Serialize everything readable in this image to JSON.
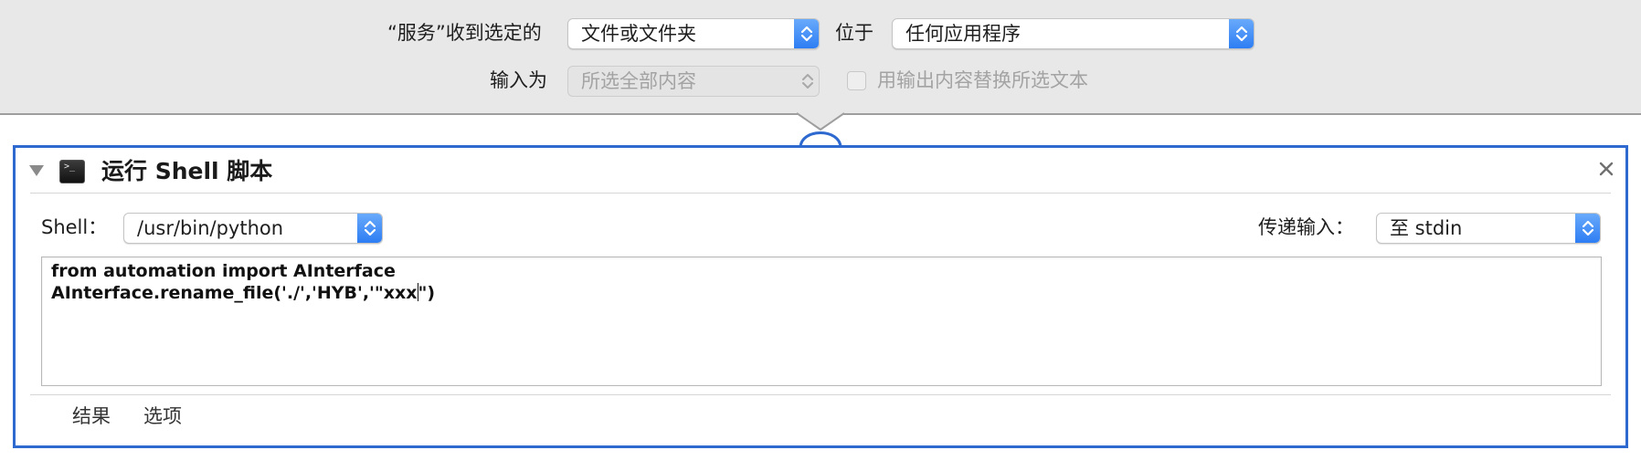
{
  "header": {
    "service_receives_label": "“服务”收到选定的",
    "input_type_value": "文件或文件夹",
    "location_label": "位于",
    "application_value": "任何应用程序",
    "input_as_label": "输入为",
    "input_as_value": "所选全部内容",
    "replace_checkbox_label": "用输出内容替换所选文本",
    "replace_checkbox_checked": false
  },
  "action": {
    "title": "运行 Shell 脚本",
    "shell_label": "Shell：",
    "shell_value": "/usr/bin/python",
    "pass_input_label": "传递输入：",
    "pass_input_value": "至 stdin",
    "code_lines": [
      "from automation import AInterface",
      "AInterface.rename_file('./','HYB','\"xxx",
      "\")"
    ],
    "tabs": [
      "结果",
      "选项"
    ]
  },
  "colors": {
    "accent": "#2d69cf",
    "stepper": "#2c7cf3",
    "header_bg": "#e8e8e8"
  },
  "icons": {
    "terminal": "terminal-icon",
    "disclosure": "disclosure-triangle-icon",
    "close": "close-icon",
    "stepper": "up-down-chevron-icon"
  }
}
